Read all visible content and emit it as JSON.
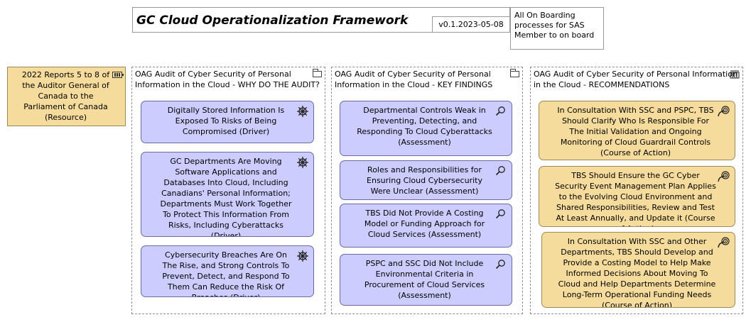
{
  "header": {
    "title": "GC Cloud Operationalization Framework",
    "version": "v0.1.2023-05-08",
    "note": "All On Boarding processes for SAS Member to on board"
  },
  "resource": {
    "text": "2022 Reports 5 to 8 of the Auditor General of Canada to the Parliament of Canada (Resource)",
    "icon": "battery-icon"
  },
  "groups": [
    {
      "label": "OAG Audit of Cyber Security of Personal Information in the Cloud - WHY DO THE AUDIT?",
      "icon": "folder-icon",
      "elements": [
        {
          "text": "Digitally Stored Information Is Exposed To Risks of Being Compromised (Driver)",
          "icon": "driver-icon"
        },
        {
          "text": "GC Departments Are Moving Software Applications and Databases Into Cloud, Including Canadians' Personal Information; Departments Must Work Together To Protect This Information From Risks, Including Cyberattacks (Driver)",
          "icon": "driver-icon"
        },
        {
          "text": "Cybersecurity Breaches Are On The Rise, and Strong Controls To Prevent, Detect, and Respond To Them Can Reduce the Risk Of Breaches (Driver)",
          "icon": "driver-icon"
        }
      ]
    },
    {
      "label": "OAG Audit of Cyber Security of Personal Information in the Cloud - KEY FINDINGS",
      "icon": "folder-icon",
      "elements": [
        {
          "text": "Departmental Controls Weak in Preventing, Detecting, and Responding To Cloud Cyberattacks (Assessment)",
          "icon": "assessment-icon"
        },
        {
          "text": "Roles and Responsibilities for Ensuring Cloud Cybersecurity Were Unclear (Assessment)",
          "icon": "assessment-icon"
        },
        {
          "text": "TBS Did Not Provide A Costing Model or Funding Approach for Cloud Services (Assessment)",
          "icon": "assessment-icon"
        },
        {
          "text": "PSPC and SSC Did Not Include Environmental Criteria in Procurement of Cloud Services (Assessment)",
          "icon": "assessment-icon"
        }
      ]
    },
    {
      "label": "OAG Audit of Cyber Security of Personal Information in the Cloud - RECOMMENDATIONS",
      "icon": "building-icon",
      "elements": [
        {
          "text": "In Consultation With SSC and PSPC, TBS Should Clarify Who Is Responsible For The Initial Validation and Ongoing Monitoring of Cloud Guardrail Controls (Course of Action)",
          "icon": "course-of-action-icon"
        },
        {
          "text": "TBS Should Ensure the GC Cyber Security Event Management Plan Applies to the Evolving Cloud Environment and Shared Responsibilities, Review and Test At Least Annually, and Update it (Course of Action)",
          "icon": "course-of-action-icon"
        },
        {
          "text": "In Consultation With SSC and Other Departments, TBS Should Develop and Provide a Costing Model to Help Make Informed Decisions About Moving To Cloud and Help Departments Determine Long-Term Operational Funding Needs (Course of Action)",
          "icon": "course-of-action-icon"
        }
      ]
    }
  ]
}
